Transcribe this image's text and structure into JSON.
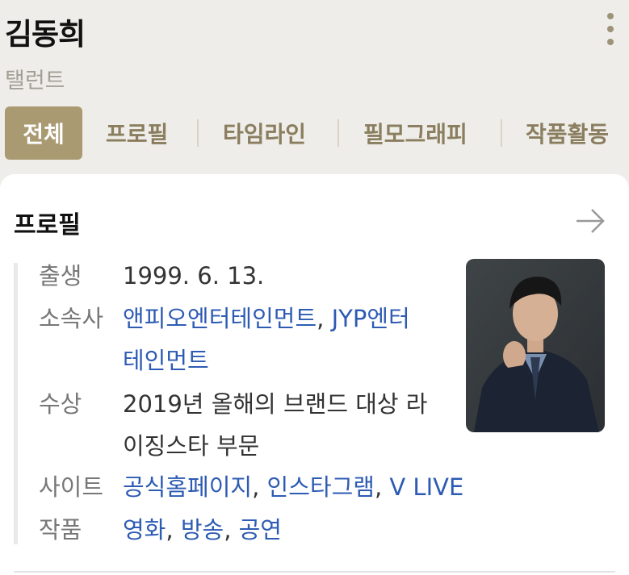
{
  "profile": {
    "name": "김동희",
    "occupation": "탤런트"
  },
  "tabs": [
    {
      "label": "전체",
      "active": true
    },
    {
      "label": "프로필",
      "active": false
    },
    {
      "label": "타임라인",
      "active": false
    },
    {
      "label": "필모그래피",
      "active": false
    },
    {
      "label": "작품활동",
      "active": false
    }
  ],
  "section": {
    "title": "프로필",
    "rows": {
      "birth": {
        "label": "출생",
        "value": "1999. 6. 13."
      },
      "agency": {
        "label": "소속사",
        "links": [
          "앤피오엔터테인먼트",
          "JYP엔터",
          "테인먼트"
        ]
      },
      "award": {
        "label": "수상",
        "line1": "2019년 올해의 브랜드 대상 라",
        "line2": "이징스타 부문"
      },
      "site": {
        "label": "사이트",
        "links": [
          "공식홈페이지",
          "인스타그램",
          "V LIVE"
        ]
      },
      "works": {
        "label": "작품",
        "links": [
          "영화",
          "방송",
          "공연"
        ]
      }
    },
    "separator": ","
  },
  "icons": {
    "more": "more-vertical-icon",
    "arrow": "arrow-right-icon"
  },
  "colors": {
    "header_bg": "#efede9",
    "accent": "#a99a72",
    "tab_text": "#8a7e5f",
    "link": "#2d5bb3",
    "more_dots": "#9c9378"
  }
}
